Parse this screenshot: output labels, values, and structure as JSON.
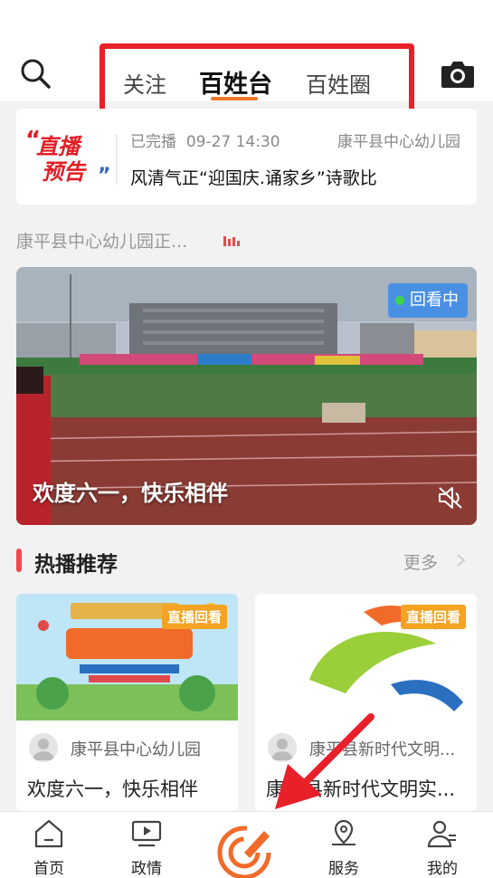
{
  "colors": {
    "accent": "#f0762a",
    "highlight_box": "#e8202a",
    "live_red": "#e21e26",
    "badge_orange": "#f4a322",
    "replay_blue": "#4a90e2"
  },
  "header": {
    "tabs": [
      {
        "label": "关注"
      },
      {
        "label": "百姓台",
        "active": true
      },
      {
        "label": "百姓圈"
      }
    ],
    "search_icon": "search-icon",
    "camera_icon": "camera-icon"
  },
  "live_preview": {
    "logo_line1": "直播",
    "logo_line2": "预告",
    "status": "已完播",
    "time": "09-27 14:30",
    "org": "康平县中心幼儿园",
    "title": "风清气正“迎国庆.诵家乡”诗歌比"
  },
  "live_section": {
    "label": "康平县中心幼儿园正..."
  },
  "video": {
    "badge": "回看中",
    "title": "欢度六一，快乐相伴"
  },
  "hot": {
    "title": "热播推荐",
    "more": "更多",
    "cards": [
      {
        "badge": "直播回看",
        "org": "康平县中心幼儿园",
        "title": "欢度六一，快乐相伴"
      },
      {
        "badge": "直播回看",
        "org": "康平县新时代文明...",
        "title": "康平县新时代文明实..."
      }
    ]
  },
  "bottom_nav": [
    {
      "label": "首页",
      "icon": "home-icon"
    },
    {
      "label": "政情",
      "icon": "tv-icon"
    },
    {
      "label": "",
      "icon": "center-action-icon"
    },
    {
      "label": "服务",
      "icon": "location-icon"
    },
    {
      "label": "我的",
      "icon": "user-icon"
    }
  ]
}
